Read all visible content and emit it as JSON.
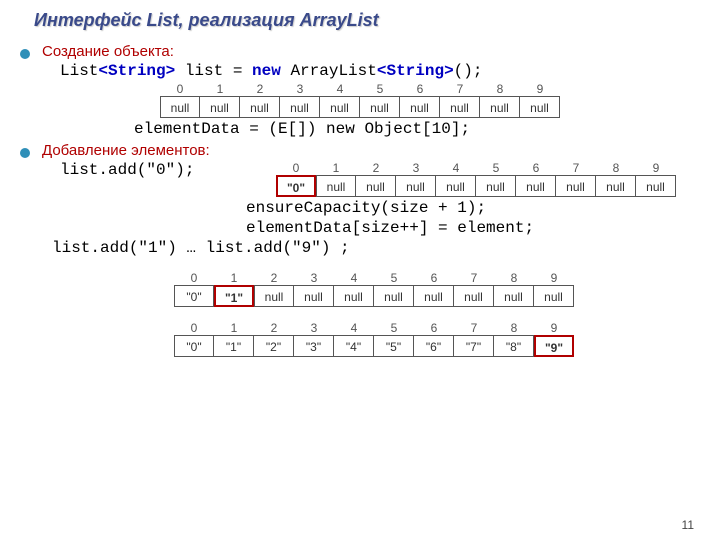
{
  "title": "Интерфейс List, реализация ArrayList",
  "section1": "Создание объекта:",
  "code1a": "List",
  "code1b": "<String>",
  "code1c": " list = ",
  "code1d": "new",
  "code1e": " ArrayList",
  "code1f": "<String>",
  "code1g": "();",
  "code2": "elementData = (E[]) new Object[10];",
  "section2": "Добавление элементов:",
  "code3": "list.add(\"0\");",
  "code4": "ensureCapacity(size + 1);",
  "code5": "elementData[size++] = element;",
  "code6": "list.add(\"1\") … list.add(\"9\") ;",
  "pageNumber": "11",
  "array1": {
    "idx": [
      "0",
      "1",
      "2",
      "3",
      "4",
      "5",
      "6",
      "7",
      "8",
      "9"
    ],
    "cells": [
      "null",
      "null",
      "null",
      "null",
      "null",
      "null",
      "null",
      "null",
      "null",
      "null"
    ],
    "highlight": -1
  },
  "array2": {
    "idx": [
      "0",
      "1",
      "2",
      "3",
      "4",
      "5",
      "6",
      "7",
      "8",
      "9"
    ],
    "cells": [
      "\"0\"",
      "null",
      "null",
      "null",
      "null",
      "null",
      "null",
      "null",
      "null",
      "null"
    ],
    "highlight": 0
  },
  "array3": {
    "idx": [
      "0",
      "1",
      "2",
      "3",
      "4",
      "5",
      "6",
      "7",
      "8",
      "9"
    ],
    "cells": [
      "\"0\"",
      "\"1\"",
      "null",
      "null",
      "null",
      "null",
      "null",
      "null",
      "null",
      "null"
    ],
    "highlight": 1
  },
  "array4": {
    "idx": [
      "0",
      "1",
      "2",
      "3",
      "4",
      "5",
      "6",
      "7",
      "8",
      "9"
    ],
    "cells": [
      "\"0\"",
      "\"1\"",
      "\"2\"",
      "\"3\"",
      "\"4\"",
      "\"5\"",
      "\"6\"",
      "\"7\"",
      "\"8\"",
      "\"9\""
    ],
    "highlight": 9
  }
}
